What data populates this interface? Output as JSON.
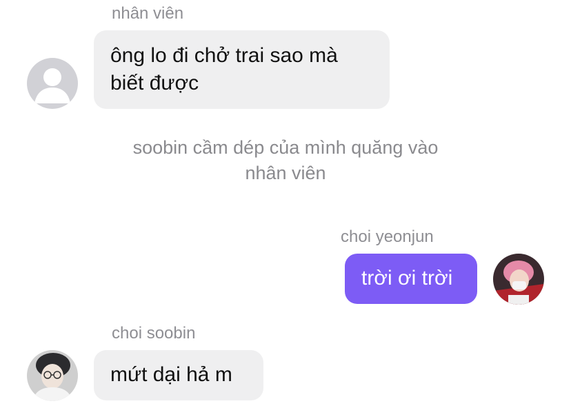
{
  "colors": {
    "incoming_bubble": "#efeff0",
    "outgoing_bubble": "#7d5cf5",
    "sender_text": "#8e8e93",
    "system_text": "#8a8a8e"
  },
  "messages": [
    {
      "sender": "nhân viên",
      "direction": "incoming",
      "avatar": "default-person-icon",
      "lines": [
        "ông lo đi chở trai sao mà",
        "biết được"
      ]
    },
    {
      "type": "system",
      "lines": [
        "soobin cầm dép của mình quăng vào",
        "nhân viên"
      ]
    },
    {
      "sender": "choi yeonjun",
      "direction": "outgoing",
      "avatar": "user-photo",
      "lines": [
        "trời ơi trời"
      ]
    },
    {
      "sender": "choi soobin",
      "direction": "incoming",
      "avatar": "user-photo",
      "lines": [
        "mứt dại hả m"
      ]
    }
  ]
}
